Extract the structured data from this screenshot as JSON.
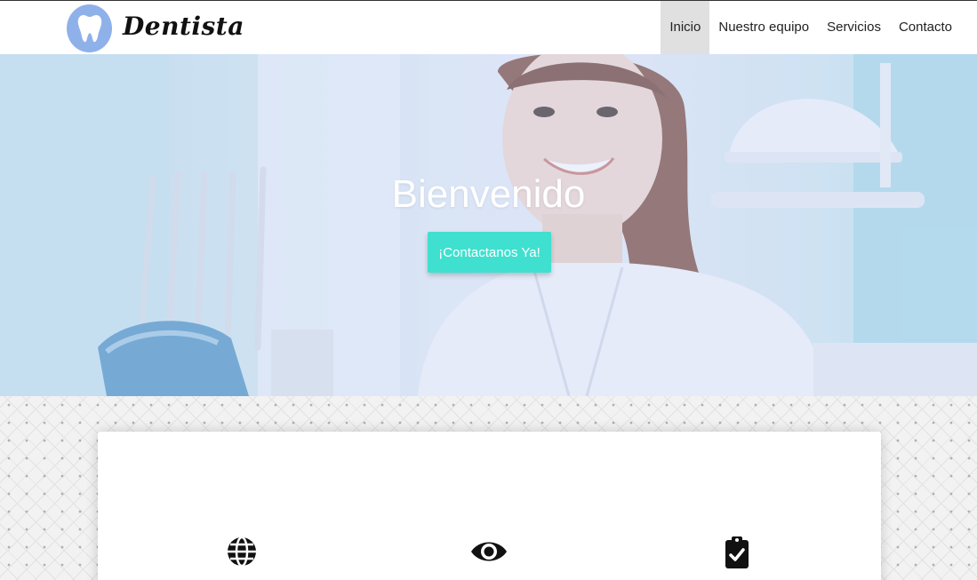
{
  "brand": {
    "name": "Dentista",
    "logo_icon": "tooth-icon",
    "logo_color": "#8fb1ea"
  },
  "nav": {
    "items": [
      {
        "label": "Inicio",
        "active": true
      },
      {
        "label": "Nuestro equipo",
        "active": false
      },
      {
        "label": "Servicios",
        "active": false
      },
      {
        "label": "Contacto",
        "active": false
      }
    ]
  },
  "hero": {
    "title": "Bienvenido",
    "cta_label": "¡Contactanos Ya!",
    "cta_color": "#3fe0cf"
  },
  "features": {
    "icons": [
      "globe-icon",
      "eye-icon",
      "clipboard-check-icon"
    ]
  }
}
